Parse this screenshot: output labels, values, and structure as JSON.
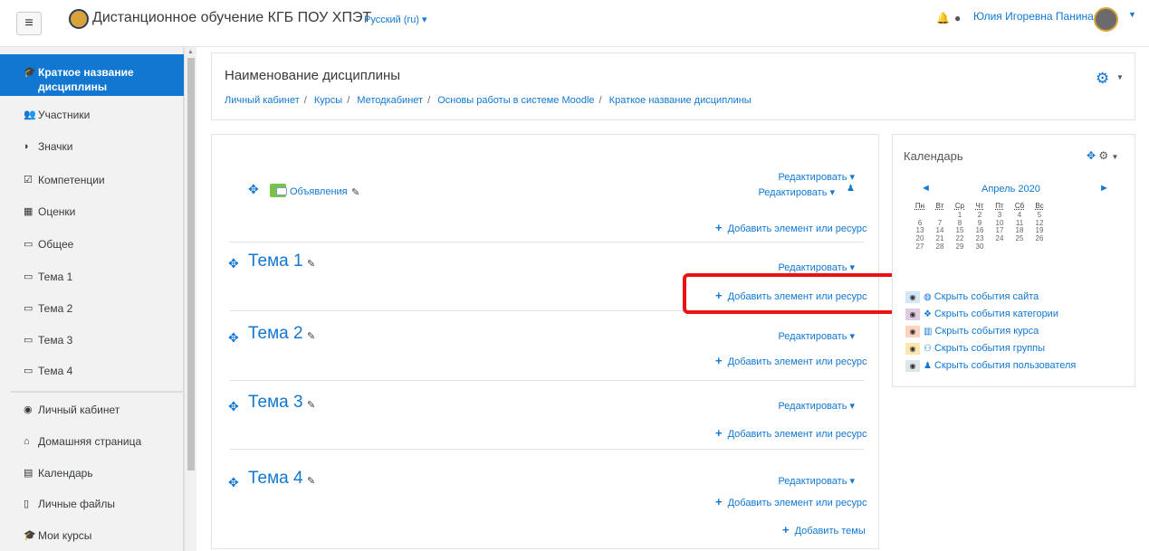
{
  "topbar": {
    "menu_icon": "hamburger-icon",
    "site_name": "Дистанционное обучение КГБ ПОУ ХПЭТ",
    "lang": "Русский (ru) ▾",
    "user_name": "Юлия Игоревна Панина"
  },
  "sidebar": {
    "items": [
      {
        "label": "Краткое название дисциплины",
        "icon": "graduation-cap-icon",
        "active": true
      },
      {
        "label": "Участники",
        "icon": "users-icon"
      },
      {
        "label": "Значки",
        "icon": "shield-icon"
      },
      {
        "label": "Компетенции",
        "icon": "checkbox-icon"
      },
      {
        "label": "Оценки",
        "icon": "table-icon"
      },
      {
        "label": "Общее",
        "icon": "folder-icon"
      },
      {
        "label": "Тема 1",
        "icon": "folder-icon"
      },
      {
        "label": "Тема 2",
        "icon": "folder-icon"
      },
      {
        "label": "Тема 3",
        "icon": "folder-icon"
      },
      {
        "label": "Тема 4",
        "icon": "folder-icon"
      }
    ],
    "nav": [
      {
        "label": "Личный кабинет",
        "icon": "dashboard-icon"
      },
      {
        "label": "Домашняя страница",
        "icon": "home-icon"
      },
      {
        "label": "Календарь",
        "icon": "calendar-icon"
      },
      {
        "label": "Личные файлы",
        "icon": "file-icon"
      },
      {
        "label": "Мои курсы",
        "icon": "graduation-cap-icon"
      }
    ]
  },
  "header": {
    "title": "Наименование дисциплины",
    "breadcrumb": [
      "Личный кабинет",
      "Курсы",
      "Методкабинет",
      "Основы работы в системе Moodle",
      "Краткое название дисциплины"
    ]
  },
  "course": {
    "edit_label": "Редактировать ▾",
    "add_resource": "Добавить элемент или ресурс",
    "forum_name": "Объявления",
    "sections": [
      "Тема 1",
      "Тема 2",
      "Тема 3",
      "Тема 4"
    ],
    "add_sections": "Добавить темы"
  },
  "calendar": {
    "title": "Календарь",
    "month": "Апрель 2020",
    "weekdays": [
      "Пн",
      "Вт",
      "Ср",
      "Чт",
      "Пт",
      "Сб",
      "Вс"
    ],
    "weeks": [
      [
        "",
        "",
        "1",
        "2",
        "3",
        "4",
        "5"
      ],
      [
        "6",
        "7",
        "8",
        "9",
        "10",
        "11",
        "12"
      ],
      [
        "13",
        "14",
        "15",
        "16",
        "17",
        "18",
        "19"
      ],
      [
        "20",
        "21",
        "22",
        "23",
        "24",
        "25",
        "26"
      ],
      [
        "27",
        "28",
        "29",
        "30",
        "",
        "",
        ""
      ]
    ],
    "events": [
      {
        "label": "Скрыть события сайта",
        "color": "#d2e6f5",
        "icon": "globe-icon"
      },
      {
        "label": "Скрыть события категории",
        "color": "#e0cbe0",
        "icon": "cubes-icon"
      },
      {
        "label": "Скрыть события курса",
        "color": "#ffd3bd",
        "icon": "university-icon"
      },
      {
        "label": "Скрыть события группы",
        "color": "#fee7ae",
        "icon": "group-icon"
      },
      {
        "label": "Скрыть события пользователя",
        "color": "#dce7ec",
        "icon": "user-icon"
      }
    ]
  },
  "colors": {
    "accent": "#1177d1",
    "highlight": "#e11111"
  }
}
